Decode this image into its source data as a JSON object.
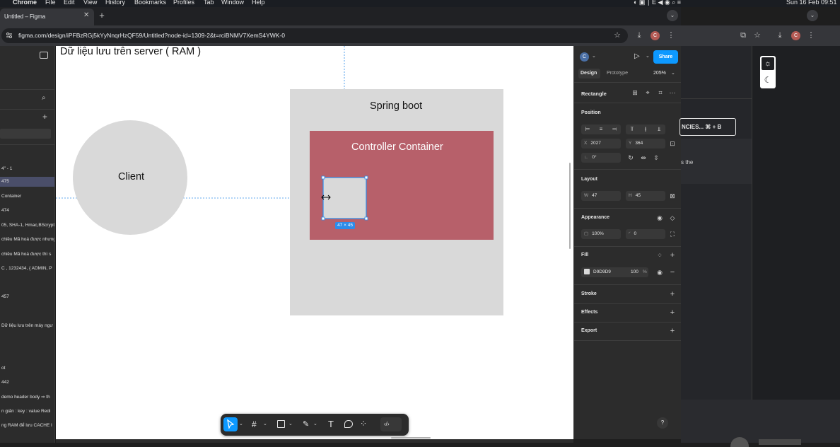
{
  "menubar": {
    "app": "Chrome",
    "items": [
      "File",
      "Edit",
      "View",
      "History",
      "Bookmarks",
      "Profiles",
      "Tab",
      "Window",
      "Help"
    ],
    "datetime": "Sun 16 Feb  09:51"
  },
  "browser": {
    "tab_title": "Untitled – Figma",
    "url": "figma.com/design/iPFBzRGj5kYyNnqrHzQF59/Untitled?node-id=1309-2&t=rciBNMV7XemS4YWK-0",
    "profile_initial": "C"
  },
  "layers": {
    "items": [
      {
        "label": "4\" - 1",
        "selected": false
      },
      {
        "label": "475",
        "selected": true
      },
      {
        "label": "Container",
        "selected": false
      },
      {
        "label": "474",
        "selected": false
      },
      {
        "label": "05, SHA-1, Hmac,BScrypt",
        "selected": false
      },
      {
        "label": "chiều Mã hoá được nhưng",
        "selected": false
      },
      {
        "label": "chiều Mã hoá được thì s",
        "selected": false
      },
      {
        "label": "C , 1232434, { ADMIN, P",
        "selected": false
      },
      {
        "label": "457",
        "selected": false
      },
      {
        "label": "Dữ liệu lưu trên máy ngư",
        "selected": false
      },
      {
        "label": "ot",
        "selected": false
      },
      {
        "label": "442",
        "selected": false
      },
      {
        "label": "demo header body ⇒ th",
        "selected": false
      },
      {
        "label": "n giản : key : value Redi",
        "selected": false
      },
      {
        "label": "ng RAM để lưu CACHE l",
        "selected": false
      }
    ]
  },
  "canvas": {
    "heading": "Dữ liệu lưu trên server ( RAM )",
    "client_label": "Client",
    "spring_label": "Spring boot",
    "controller_label": "Controller Container",
    "selection_size": "47 × 45",
    "colors": {
      "gray": "#D9D9D9",
      "controller": "#B7606A",
      "selection": "#2D8CEA"
    }
  },
  "design_panel": {
    "user_initial": "C",
    "share_label": "Share",
    "tabs": [
      "Design",
      "Prototype"
    ],
    "zoom": "205%",
    "layer_type": "Rectangle",
    "position_title": "Position",
    "x_label": "X",
    "x_value": "2027",
    "y_label": "Y",
    "y_value": "364",
    "rotation_value": "0°",
    "layout_title": "Layout",
    "w_label": "W",
    "w_value": "47",
    "h_label": "H",
    "h_value": "45",
    "appearance_title": "Appearance",
    "opacity_value": "100%",
    "radius_value": "0",
    "fill_title": "Fill",
    "fill_hex": "D9D9D9",
    "fill_opacity": "100",
    "fill_percent": "%",
    "stroke_title": "Stroke",
    "effects_title": "Effects",
    "export_title": "Export",
    "help": "?"
  },
  "right_app": {
    "button_text": "NCIES...  ⌘ + B",
    "snippet": "s the"
  }
}
